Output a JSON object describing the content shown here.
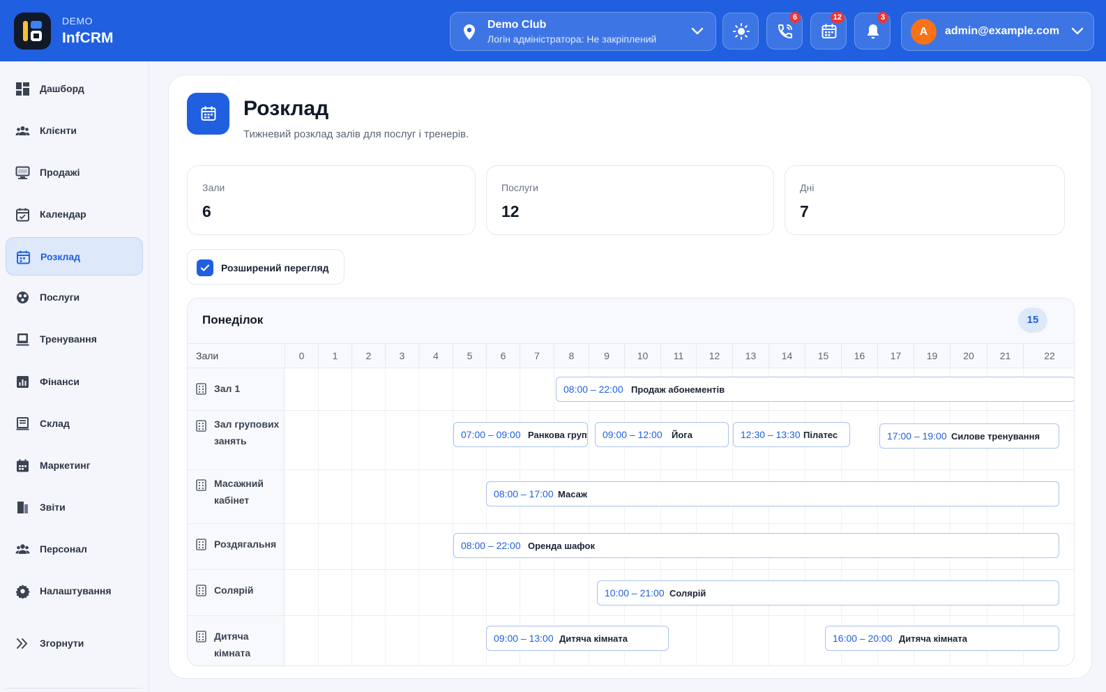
{
  "brand": {
    "tag": "DEMO",
    "name": "InfCRM"
  },
  "club": {
    "name": "Demo Club",
    "subtitle": "Логін адміністратора: Не закріплений"
  },
  "header_badges": {
    "calls": "6",
    "calendar": "12",
    "notifications": "3"
  },
  "user": {
    "avatar_letter": "A",
    "email": "admin@example.com"
  },
  "sidebar": {
    "items": [
      {
        "label": "Дашборд",
        "icon": "dashboard-icon"
      },
      {
        "label": "Клієнти",
        "icon": "clients-icon"
      },
      {
        "label": "Продажі",
        "icon": "sales-icon"
      },
      {
        "label": "Календар",
        "icon": "calendar-icon"
      },
      {
        "label": "Розклад",
        "icon": "schedule-icon",
        "active": true
      },
      {
        "label": "Послуги",
        "icon": "services-icon"
      },
      {
        "label": "Тренування",
        "icon": "training-icon"
      },
      {
        "label": "Фінанси",
        "icon": "finance-icon"
      },
      {
        "label": "Склад",
        "icon": "warehouse-icon"
      },
      {
        "label": "Маркетинг",
        "icon": "marketing-icon"
      },
      {
        "label": "Звіти",
        "icon": "reports-icon"
      },
      {
        "label": "Персонал",
        "icon": "staff-icon"
      },
      {
        "label": "Налаштування",
        "icon": "settings-icon"
      }
    ],
    "collapse_label": "Згорнути"
  },
  "page": {
    "title": "Розклад",
    "subtitle": "Тижневий розклад залів для послуг і тренерів."
  },
  "stats": [
    {
      "label": "Зали",
      "value": "6"
    },
    {
      "label": "Послуги",
      "value": "12"
    },
    {
      "label": "Дні",
      "value": "7"
    }
  ],
  "extended_view": {
    "label": "Розширений перегляд",
    "checked": true
  },
  "schedule": {
    "day": "Понеділок",
    "count": "15",
    "halls_header": "Зали",
    "hours": [
      "0",
      "1",
      "2",
      "3",
      "4",
      "5",
      "6",
      "7",
      "8",
      "9",
      "10",
      "11",
      "12",
      "13",
      "14",
      "15",
      "16",
      "17",
      "19",
      "20",
      "21",
      "22"
    ],
    "rows": [
      {
        "hall": "Зал 1",
        "events": [
          {
            "time": "08:00 – 22:00",
            "name": "Продаж абонементів"
          }
        ]
      },
      {
        "hall": "Зал групових занять",
        "events": [
          {
            "time": "07:00 – 09:00",
            "name": "Ранкова груп"
          },
          {
            "time": "09:00 – 12:00",
            "name": "Йога"
          },
          {
            "time": "12:30 – 13:30",
            "name": "Пілатес"
          },
          {
            "time": "17:00 – 19:00",
            "name": "Силове тренування"
          }
        ]
      },
      {
        "hall": "Масажний кабінет",
        "events": [
          {
            "time": "08:00 – 17:00",
            "name": "Масаж"
          }
        ]
      },
      {
        "hall": "Роздягальня",
        "events": [
          {
            "time": "08:00 – 22:00",
            "name": "Оренда шафок"
          }
        ]
      },
      {
        "hall": "Солярій",
        "events": [
          {
            "time": "10:00 – 21:00",
            "name": "Солярій"
          }
        ]
      },
      {
        "hall": "Дитяча кімната",
        "events": [
          {
            "time": "09:00 – 13:00",
            "name": "Дитяча кімната"
          },
          {
            "time": "16:00 – 20:00",
            "name": "Дитяча кімната"
          }
        ]
      }
    ]
  },
  "colors": {
    "primary": "#1f5fe0",
    "accent_avatar": "#f97316",
    "badge": "#e5383b"
  }
}
